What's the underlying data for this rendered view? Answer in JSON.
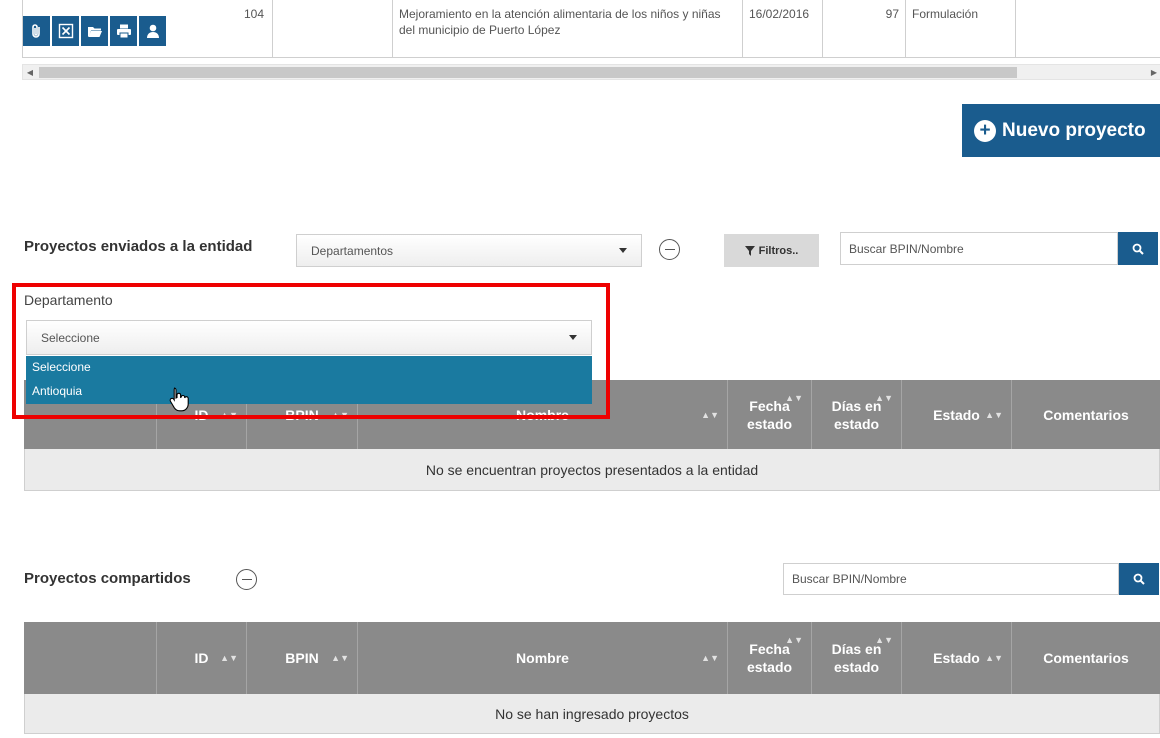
{
  "top_row": {
    "id": "104",
    "nombre": "Mejoramiento en la atención alimentaria de los niños y niñas del municipio de  Puerto López",
    "fecha": "16/02/2016",
    "dias": "97",
    "estado": "Formulación"
  },
  "icons": [
    "paperclip-icon",
    "close-box-icon",
    "folder-open-icon",
    "print-icon",
    "user-icon"
  ],
  "nuevo_proyecto_label": "Nuevo proyecto",
  "enviados": {
    "title": "Proyectos enviados a la entidad",
    "filter_select_value": "Departamentos",
    "filtros_label": "Filtros..",
    "search_placeholder": "Buscar BPIN/Nombre",
    "departamento_label": "Departamento",
    "departamento_select_value": "Seleccione",
    "dropdown_options": [
      "Seleccione",
      "Antioquia"
    ],
    "empty_text": "No se encuentran proyectos presentados a la entidad"
  },
  "columns": {
    "id": "ID",
    "bpin": "BPIN",
    "nombre": "Nombre",
    "fecha_estado": "Fecha estado",
    "dias_estado": "Días en estado",
    "estado": "Estado",
    "comentarios": "Comentarios"
  },
  "compartidos": {
    "title": "Proyectos compartidos",
    "search_placeholder": "Buscar BPIN/Nombre",
    "empty_text": "No se han ingresado proyectos"
  },
  "colors": {
    "primary": "#1a5c8e",
    "dropdown_highlight": "#1a7aa0",
    "table_header": "#8a8a8a",
    "annotation_red": "#ee0000"
  }
}
